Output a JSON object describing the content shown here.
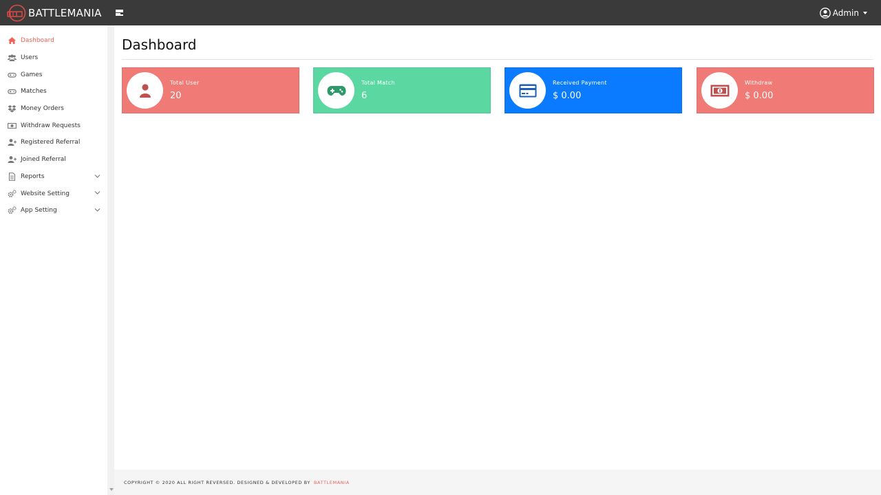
{
  "header": {
    "brand": "BATTLEMANIA",
    "user": "Admin"
  },
  "sidebar": {
    "items": [
      {
        "label": "Dashboard",
        "icon": "home-icon",
        "active": true
      },
      {
        "label": "Users",
        "icon": "users-icon"
      },
      {
        "label": "Games",
        "icon": "gamepad-icon"
      },
      {
        "label": "Matches",
        "icon": "gamepad-icon"
      },
      {
        "label": "Money Orders",
        "icon": "dropbox-icon"
      },
      {
        "label": "Withdraw Requests",
        "icon": "money-bill-icon"
      },
      {
        "label": "Registered Referral",
        "icon": "user-plus-icon"
      },
      {
        "label": "Joined Referral",
        "icon": "user-plus-icon"
      },
      {
        "label": "Reports",
        "icon": "file-icon",
        "expandable": true
      },
      {
        "label": "Website Setting",
        "icon": "cogs-icon",
        "expandable": true
      },
      {
        "label": "App Setting",
        "icon": "cogs-icon",
        "expandable": true
      }
    ]
  },
  "main": {
    "title": "Dashboard",
    "cards": [
      {
        "label": "Total User",
        "value": "20",
        "color": "#f07a75",
        "icon": "user-icon",
        "icon_color": "#c0504d"
      },
      {
        "label": "Total Match",
        "value": "6",
        "color": "#5bd8a1",
        "icon": "gamepad-icon",
        "icon_color": "#2e9a6a"
      },
      {
        "label": "Received Payment",
        "value": "$ 0.00",
        "color": "#0a7bff",
        "icon": "credit-card-icon",
        "icon_color": "#1d5fb8"
      },
      {
        "label": "Withdraw",
        "value": "$ 0.00",
        "color": "#f07a75",
        "icon": "money-bill-icon",
        "icon_color": "#c0504d"
      }
    ]
  },
  "footer": {
    "text": "COPYRIGHT © 2020 ALL RIGHT REVERSED. DESIGNED & DEVELOPED BY",
    "brand": "BATTLEMANIA"
  },
  "colors": {
    "topbar": "#3a3a3a",
    "accent": "#f0625a"
  }
}
